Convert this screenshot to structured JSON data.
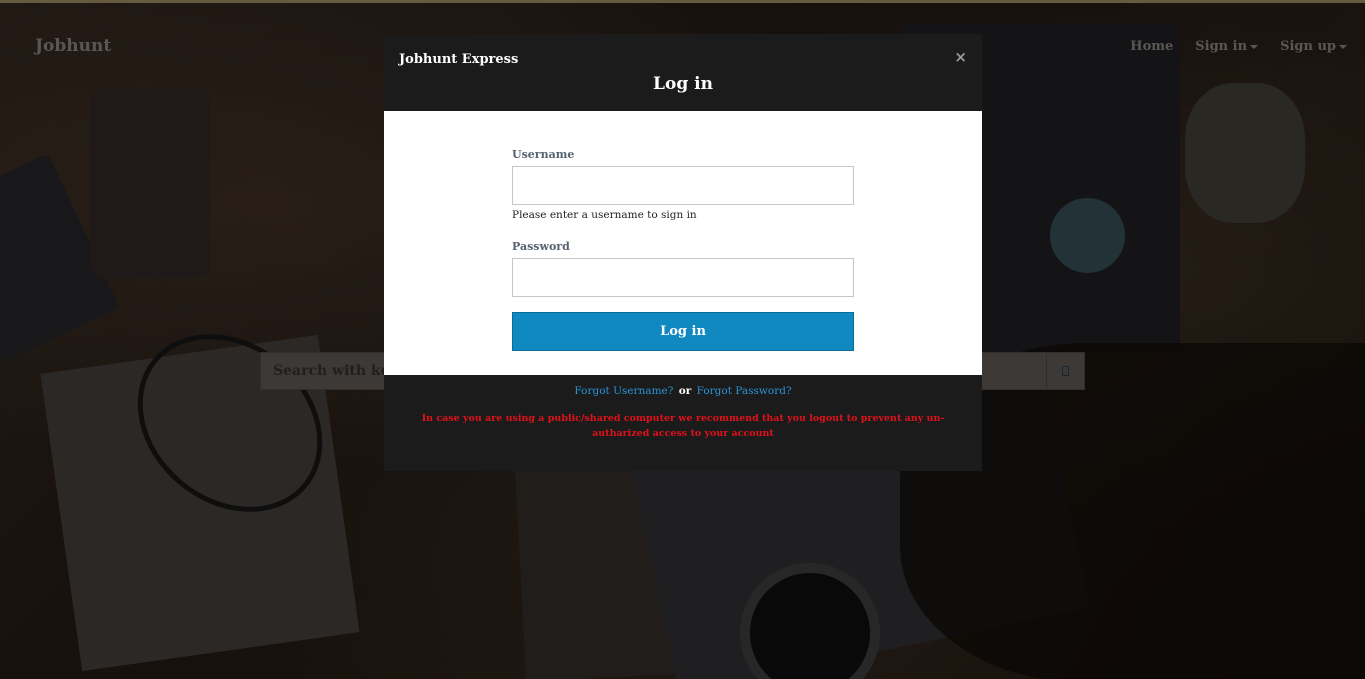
{
  "navbar": {
    "brand": "Jobhunt",
    "links": [
      {
        "label": "Home",
        "has_caret": false
      },
      {
        "label": "Sign in",
        "has_caret": true
      },
      {
        "label": "Sign up",
        "has_caret": true
      }
    ]
  },
  "search": {
    "placeholder": "Search with keywords",
    "button_icon": "search-icon"
  },
  "modal": {
    "brand": "Jobhunt Express",
    "title": "Log in",
    "close_label": "×",
    "username_label": "Username",
    "username_value": "",
    "username_help": "Please enter a username to sign in",
    "password_label": "Password",
    "password_value": "",
    "login_button": "Log in",
    "forgot_username": "Forgot Username?",
    "or_text": "or",
    "forgot_password": "Forgot Password?",
    "warning": "In case you are using a public/shared computer we recommend that you logout to prevent any un-autharized access to your account"
  },
  "colors": {
    "primary_button": "#0f89bf",
    "link": "#2a93d5",
    "warning": "#e0111b",
    "modal_dark": "#1b1b1b"
  }
}
